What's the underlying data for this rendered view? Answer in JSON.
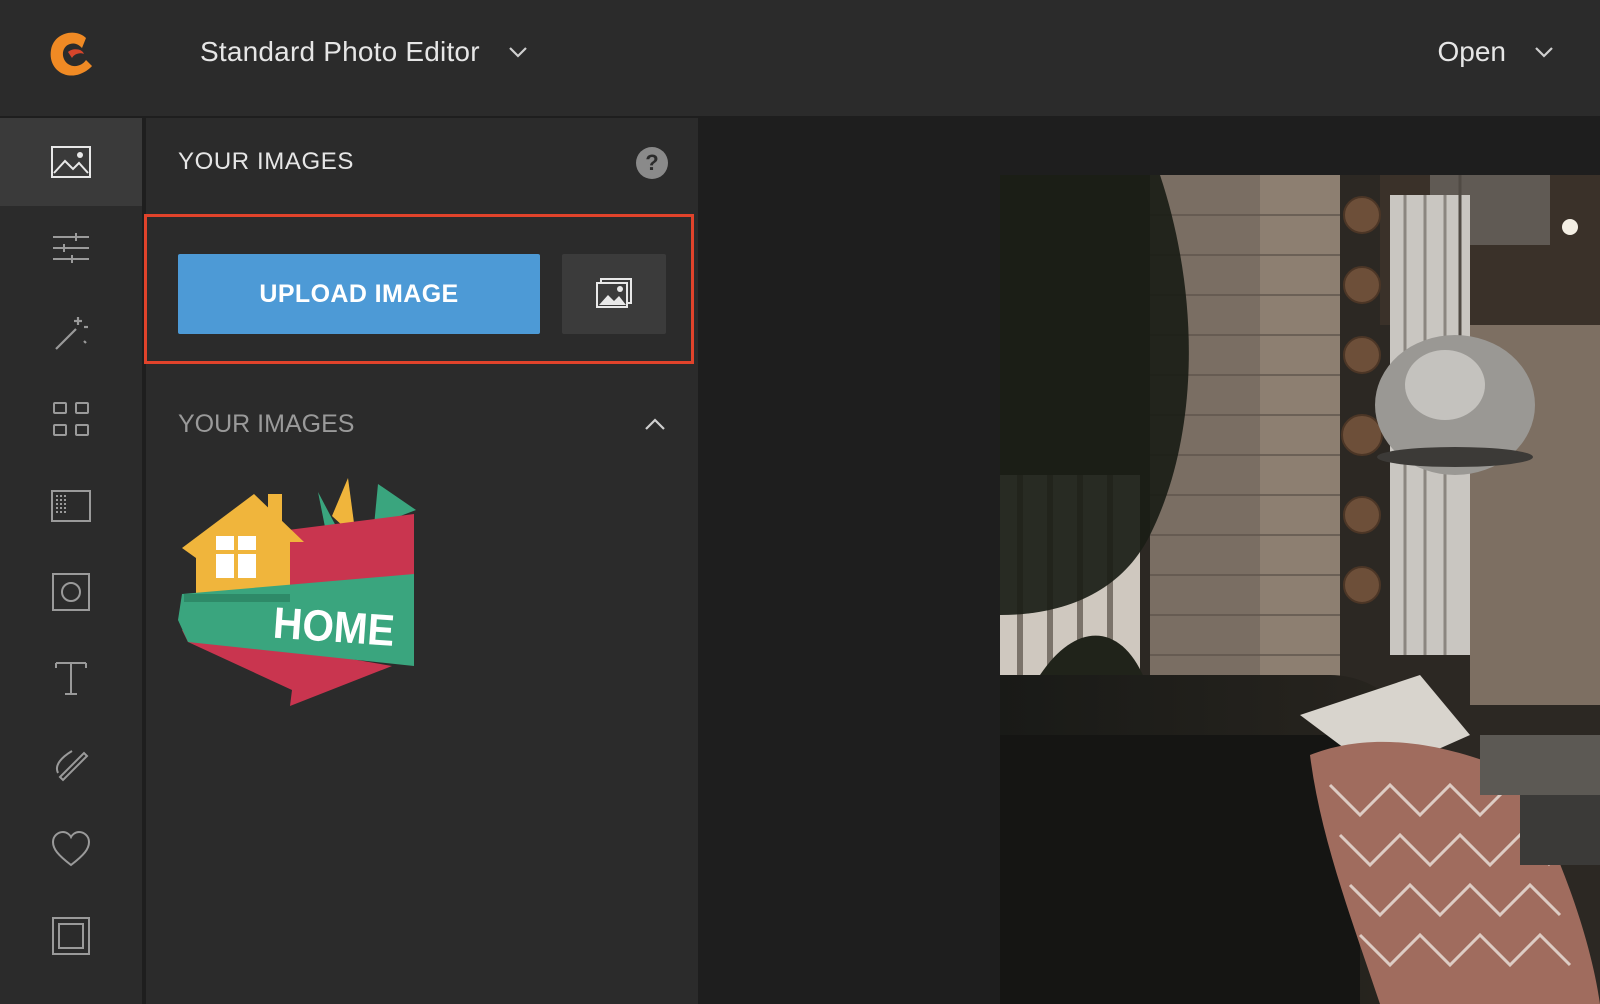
{
  "header": {
    "editor_label": "Standard Photo Editor",
    "editor_icon": "chevron-down-icon",
    "open_label": "Open",
    "open_icon": "chevron-down-icon",
    "logo_icon": "app-logo-icon"
  },
  "rail": {
    "items": [
      {
        "icon": "image-icon",
        "active": true
      },
      {
        "icon": "sliders-icon"
      },
      {
        "icon": "magic-wand-icon"
      },
      {
        "icon": "grid-icon"
      },
      {
        "icon": "texture-icon"
      },
      {
        "icon": "frame-circle-icon"
      },
      {
        "icon": "text-icon"
      },
      {
        "icon": "brush-icon"
      },
      {
        "icon": "heart-icon"
      },
      {
        "icon": "border-frame-icon"
      }
    ]
  },
  "panel": {
    "title": "YOUR IMAGES",
    "upload_label": "UPLOAD IMAGE",
    "section_label": "YOUR IMAGES",
    "thumbnail_text": "HOME"
  },
  "colors": {
    "accent": "#4d9ad6",
    "highlight": "#e1432b",
    "logo": "#f08a24"
  }
}
